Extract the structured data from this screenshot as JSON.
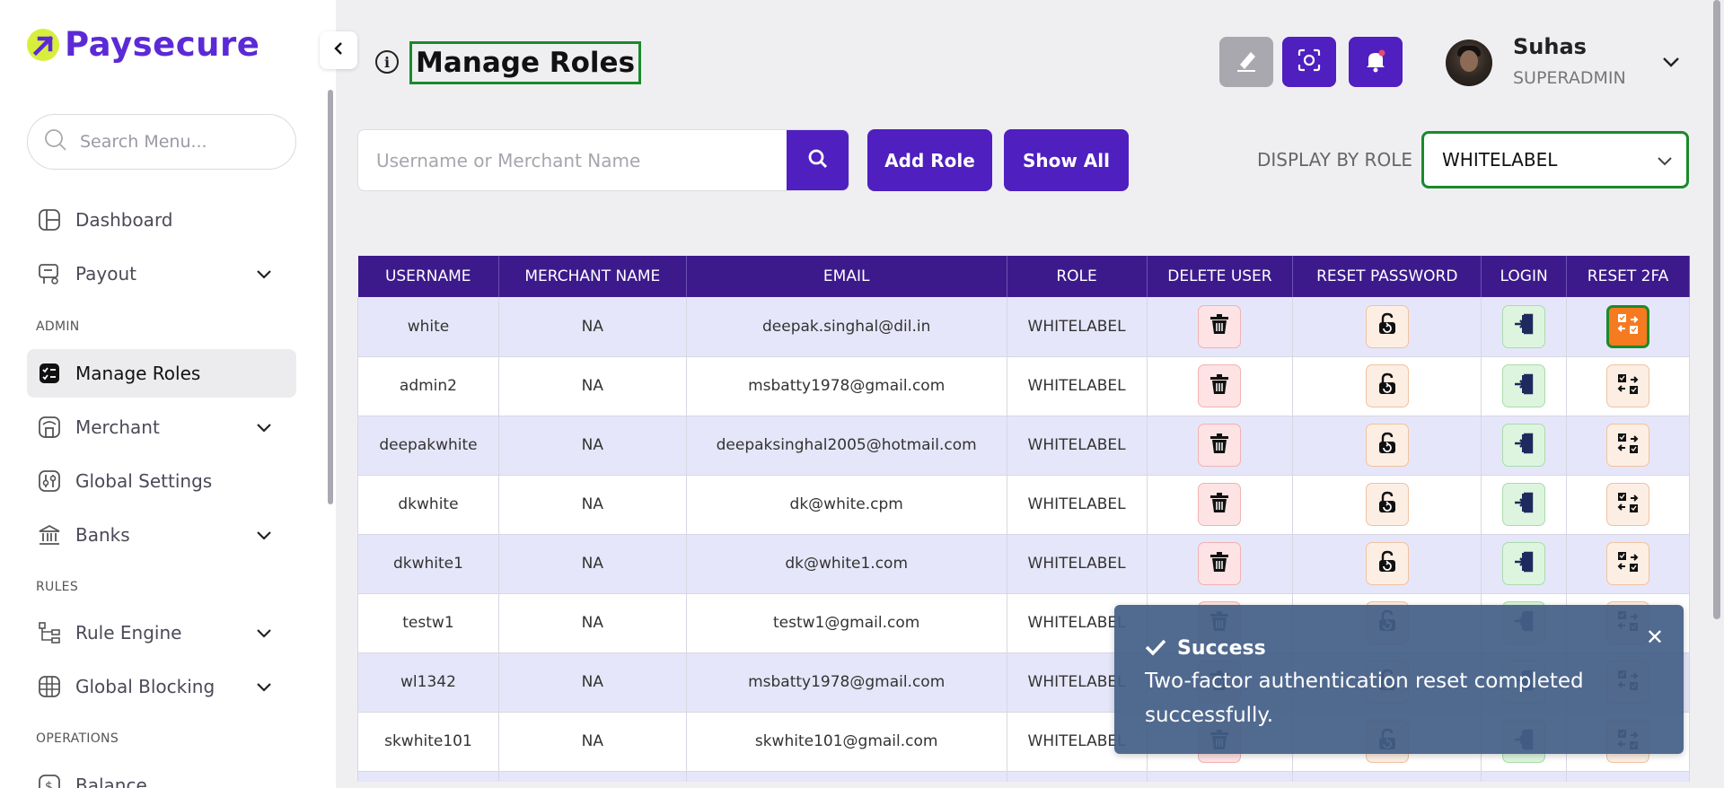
{
  "brand": {
    "name": "Paysecure"
  },
  "sidebar": {
    "search_placeholder": "Search Menu...",
    "items": [
      {
        "label": "Dashboard",
        "icon": "dashboard-icon"
      },
      {
        "label": "Payout",
        "icon": "payout-icon",
        "expandable": true
      },
      {
        "label": "Manage Roles",
        "icon": "manage-roles-icon",
        "active": true
      },
      {
        "label": "Merchant",
        "icon": "merchant-icon",
        "expandable": true
      },
      {
        "label": "Global Settings",
        "icon": "settings-icon"
      },
      {
        "label": "Banks",
        "icon": "bank-icon",
        "expandable": true
      },
      {
        "label": "Rule Engine",
        "icon": "rule-engine-icon",
        "expandable": true
      },
      {
        "label": "Global Blocking",
        "icon": "globe-icon",
        "expandable": true
      },
      {
        "label": "Balance",
        "icon": "balance-icon"
      }
    ],
    "sections": {
      "admin": "ADMIN",
      "rules": "RULES",
      "operations": "OPERATIONS"
    }
  },
  "header": {
    "title": "Manage Roles",
    "user": {
      "name": "Suhas",
      "role": "SUPERADMIN"
    }
  },
  "toolbar": {
    "search_placeholder": "Username or Merchant Name",
    "add_role_label": "Add Role",
    "show_all_label": "Show All",
    "display_by_role_label": "DISPLAY BY ROLE",
    "role_selected": "WHITELABEL"
  },
  "table": {
    "columns": [
      "USERNAME",
      "MERCHANT NAME",
      "EMAIL",
      "ROLE",
      "DELETE USER",
      "RESET PASSWORD",
      "LOGIN",
      "RESET 2FA"
    ],
    "rows": [
      {
        "username": "white",
        "merchant": "NA",
        "email": "deepak.singhal@dil.in",
        "role": "WHITELABEL"
      },
      {
        "username": "admin2",
        "merchant": "NA",
        "email": "msbatty1978@gmail.com",
        "role": "WHITELABEL"
      },
      {
        "username": "deepakwhite",
        "merchant": "NA",
        "email": "deepaksinghal2005@hotmail.com",
        "role": "WHITELABEL"
      },
      {
        "username": "dkwhite",
        "merchant": "NA",
        "email": "dk@white.cpm",
        "role": "WHITELABEL"
      },
      {
        "username": "dkwhite1",
        "merchant": "NA",
        "email": "dk@white1.com",
        "role": "WHITELABEL"
      },
      {
        "username": "testw1",
        "merchant": "NA",
        "email": "testw1@gmail.com",
        "role": "WHITELABEL"
      },
      {
        "username": "wl1342",
        "merchant": "NA",
        "email": "msbatty1978@gmail.com",
        "role": "WHITELABEL"
      },
      {
        "username": "skwhite101",
        "merchant": "NA",
        "email": "skwhite101@gmail.com",
        "role": "WHITELABEL"
      }
    ]
  },
  "toast": {
    "title": "Success",
    "message": "Two-factor authentication reset completed successfully."
  },
  "colors": {
    "brand_purple": "#4f1fbf",
    "table_header": "#3d1a8c",
    "row_alt": "#e6e6fa",
    "highlight_green": "#1b8a2a",
    "active_orange": "#f57a20",
    "toast_bg": "#445f87"
  }
}
